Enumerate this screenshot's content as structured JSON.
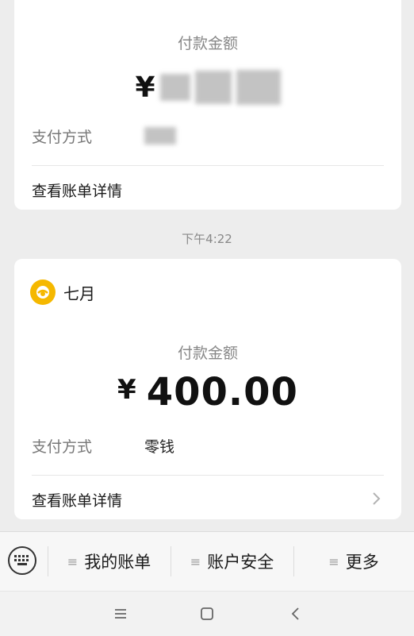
{
  "card_top": {
    "amount_label": "付款金额",
    "currency_symbol": "¥",
    "pay_method_label": "支付方式",
    "view_details": "查看账单详情"
  },
  "timestamp": "下午4:22",
  "card_main": {
    "merchant_name": "七月",
    "amount_label": "付款金额",
    "amount": "¥ 400.00",
    "amount_number": "400.00",
    "currency_symbol": "¥",
    "pay_method_label": "支付方式",
    "pay_method_value": "零钱",
    "view_details": "查看账单详情"
  },
  "menu": {
    "items": [
      {
        "label": "我的账单",
        "icon": "menu-list-icon"
      },
      {
        "label": "账户安全",
        "icon": "menu-list-icon"
      },
      {
        "label": "更多",
        "icon": "menu-list-icon"
      }
    ],
    "keyboard_icon": "keyboard-icon"
  },
  "nav": {
    "icons": [
      "menu-icon",
      "home-icon",
      "back-icon"
    ]
  },
  "colors": {
    "background": "#ededed",
    "card": "#ffffff",
    "merchant_logo": "#f5b800",
    "muted_text": "#888888"
  }
}
